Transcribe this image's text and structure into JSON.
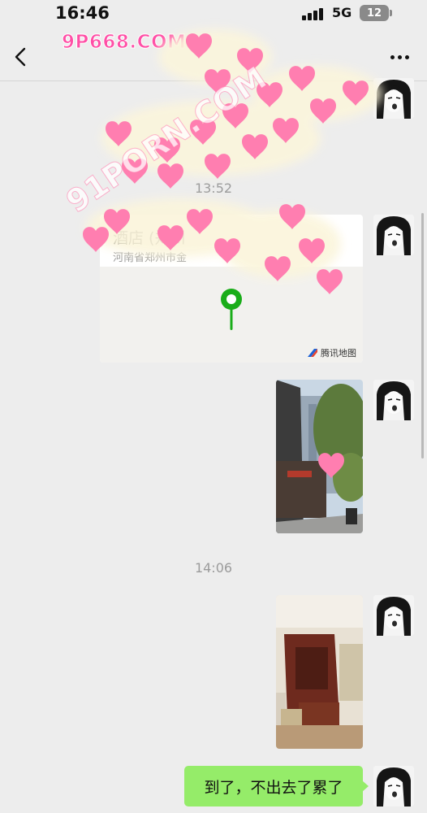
{
  "status_bar": {
    "time": "16:46",
    "network": "5G",
    "battery": "12"
  },
  "watermark": {
    "logo_text": "9P668.COM",
    "diagonal_text": "91PORN.COM"
  },
  "icons": {
    "back": "chevron-left-icon",
    "more": "more-dots-icon",
    "map_pin": "map-pin-icon",
    "map_brand": "tencent-map-icon"
  },
  "messages": {
    "timestamp_1": "13:52",
    "location": {
      "title": "酒店 (郑州",
      "address": "河南省郑州市金",
      "brand": "腾讯地图"
    },
    "timestamp_2": "14:06",
    "text_message": "到了，不出去了累了"
  },
  "colors": {
    "background": "#ededed",
    "sent_bubble": "#95ec69",
    "map_pin": "#1aad19",
    "watermark_pink": "#ff4fa6"
  }
}
